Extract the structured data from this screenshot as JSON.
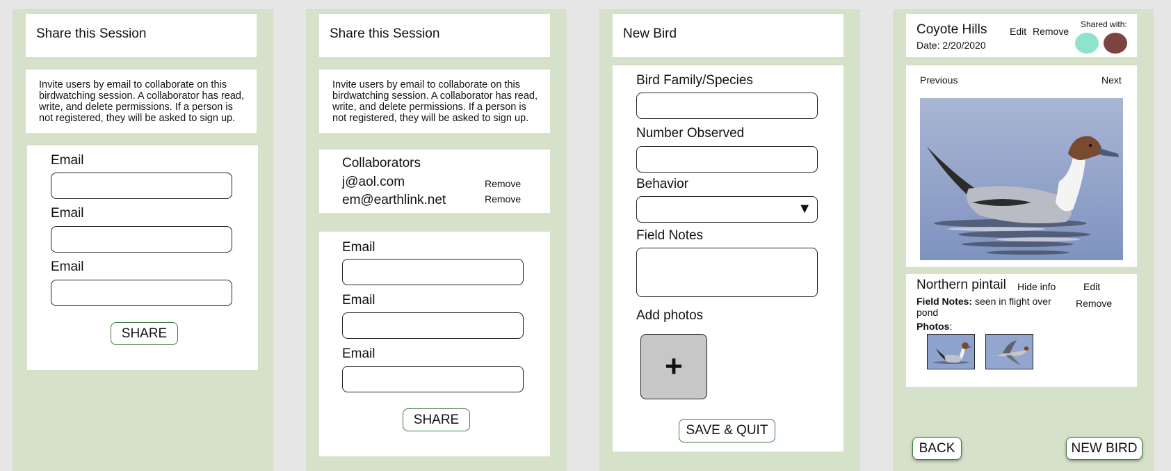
{
  "share_panel_1": {
    "title": "Share this Session",
    "description": "Invite users by email to collaborate on this birdwatching session. A collaborator has read, write, and delete permissions. If a person is not registered, they will be asked to sign up.",
    "email_labels": [
      "Email",
      "Email",
      "Email"
    ],
    "share_label": "SHARE"
  },
  "share_panel_2": {
    "title": "Share this Session",
    "description": "Invite users by email to collaborate on this birdwatching session. A collaborator has read, write, and delete permissions. If a person is not registered, they will be asked to sign up.",
    "collaborators_heading": "Collaborators",
    "collaborators": [
      {
        "email": "j@aol.com",
        "action": "Remove"
      },
      {
        "email": "em@earthlink.net",
        "action": "Remove"
      }
    ],
    "email_labels": [
      "Email",
      "Email",
      "Email"
    ],
    "share_label": "SHARE"
  },
  "new_bird": {
    "title": "New Bird",
    "family_label": "Bird Family/Species",
    "number_label": "Number Observed",
    "behavior_label": "Behavior",
    "dropdown_arrow": "▼",
    "notes_label": "Field Notes",
    "photos_label": "Add photos",
    "add_icon": "+",
    "save_label": "SAVE & QUIT"
  },
  "session": {
    "location": "Coyote Hills",
    "date": "Date: 2/20/2020",
    "edit_label": "Edit",
    "remove_label": "Remove",
    "shared_with_label": "Shared with:",
    "avatar_colors": [
      "#8ee3cf",
      "#7b4441"
    ],
    "previous_label": "Previous",
    "next_label": "Next",
    "bird_name": "Northern pintail",
    "hide_info_label": "Hide info",
    "bird_edit_label": "Edit",
    "bird_remove_label": "Remove",
    "field_notes_key": "Field Notes:",
    "field_notes_value": " seen in flight over pond",
    "photos_key": "Photos",
    "photos_colon": ":",
    "back_label": "BACK",
    "new_bird_label": "NEW BIRD"
  }
}
